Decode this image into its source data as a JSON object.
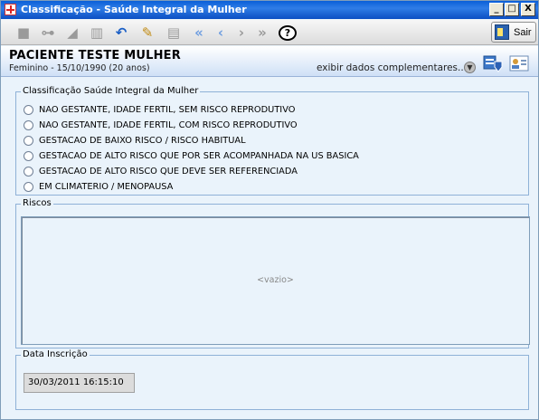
{
  "window": {
    "title": "Classificação - Saúde Integral da Mulher",
    "controls": [
      "_",
      "□",
      "X"
    ]
  },
  "toolbar": {
    "buttons": [
      {
        "icon": "new-icon",
        "enabled": false
      },
      {
        "icon": "binoculars-icon",
        "enabled": false
      },
      {
        "icon": "eraser-icon",
        "enabled": false
      },
      {
        "icon": "trash-icon",
        "enabled": false
      },
      {
        "icon": "undo-icon",
        "enabled": true
      },
      {
        "icon": "edit-icon",
        "enabled": true
      },
      {
        "icon": "print-icon",
        "enabled": false
      },
      {
        "icon": "first-icon",
        "enabled": true
      },
      {
        "icon": "previous-icon",
        "enabled": true
      },
      {
        "icon": "next-icon",
        "enabled": false
      },
      {
        "icon": "last-icon",
        "enabled": false
      },
      {
        "icon": "help-icon",
        "enabled": true
      }
    ],
    "exit_label": "Sair"
  },
  "patient": {
    "name": "PACIENTE TESTE MULHER",
    "info": "Feminino - 15/10/1990 (20 anos)",
    "more_label": "exibir dados complementares..."
  },
  "classification": {
    "legend": "Classificação Saúde Integral da Mulher",
    "options": [
      "NAO GESTANTE, IDADE FERTIL, SEM RISCO REPRODUTIVO",
      "NAO GESTANTE, IDADE FERTIL, COM RISCO REPRODUTIVO",
      "GESTACAO DE BAIXO RISCO / RISCO HABITUAL",
      "GESTACAO DE ALTO RISCO QUE POR SER ACOMPANHADA NA US BASICA",
      "GESTACAO DE ALTO RISCO QUE DEVE SER REFERENCIADA",
      "EM CLIMATERIO / MENOPAUSA"
    ]
  },
  "riscos": {
    "legend": "Riscos",
    "empty_text": "<vazio>"
  },
  "inscricao": {
    "legend": "Data Inscrição",
    "value": "30/03/2011 16:15:10"
  }
}
